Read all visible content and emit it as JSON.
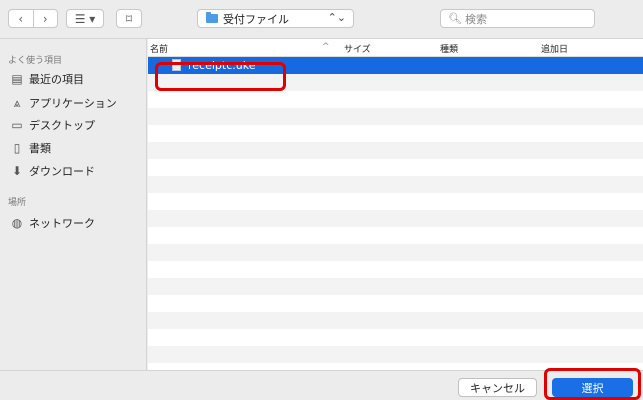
{
  "toolbar": {
    "back": "‹",
    "forward": "›",
    "view": "☰ ▾",
    "newfolder": "⌑",
    "location": "受付ファイル",
    "location_chevron": "⌃⌄",
    "search_placeholder": "検索"
  },
  "sidebar": {
    "favorites_header": "よく使う項目",
    "items": [
      {
        "label": "最近の項目",
        "icon": "recents-icon"
      },
      {
        "label": "アプリケーション",
        "icon": "applications-icon"
      },
      {
        "label": "デスクトップ",
        "icon": "desktop-icon"
      },
      {
        "label": "書類",
        "icon": "documents-icon"
      },
      {
        "label": "ダウンロード",
        "icon": "downloads-icon"
      }
    ],
    "places_header": "場所",
    "places": [
      {
        "label": "ネットワーク",
        "icon": "network-icon"
      }
    ]
  },
  "filelist": {
    "columns": [
      "名前",
      "サイズ",
      "種類",
      "追加日"
    ],
    "sort_indicator": "^",
    "files": [
      {
        "name": "receiptc.uke",
        "selected": true
      }
    ]
  },
  "footer": {
    "cancel": "キャンセル",
    "choose": "選択"
  },
  "colors": {
    "selection": "#1769e0",
    "highlight": "#e00000"
  }
}
